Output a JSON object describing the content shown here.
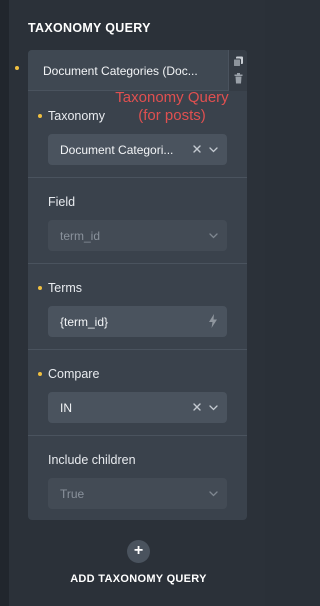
{
  "section": {
    "title": "TAXONOMY QUERY"
  },
  "card": {
    "title": "Document Categories (Doc...",
    "actions": {
      "copy_icon": "copy-icon",
      "delete_icon": "trash-icon"
    }
  },
  "annotation": {
    "line1": "Taxonomy Query",
    "line2": "(for posts)"
  },
  "fields": {
    "taxonomy": {
      "label": "Taxonomy",
      "value": "Document Categori...",
      "clear_icon": "x-icon",
      "dropdown_icon": "chevron-down-icon"
    },
    "field": {
      "label": "Field",
      "placeholder": "term_id",
      "dropdown_icon": "chevron-down-icon"
    },
    "terms": {
      "label": "Terms",
      "value": "{term_id}",
      "dynamic_icon": "bolt-icon"
    },
    "compare": {
      "label": "Compare",
      "value": "IN",
      "clear_icon": "x-icon",
      "dropdown_icon": "chevron-down-icon"
    },
    "include_children": {
      "label": "Include children",
      "placeholder": "True",
      "dropdown_icon": "chevron-down-icon"
    }
  },
  "add": {
    "icon_glyph": "+",
    "label": "ADD TAXONOMY QUERY"
  },
  "colors": {
    "background": "#2b3139",
    "card": "#3a424c",
    "control": "#4a535e",
    "accent_dot": "#f0c040",
    "annotation": "#e05050"
  }
}
